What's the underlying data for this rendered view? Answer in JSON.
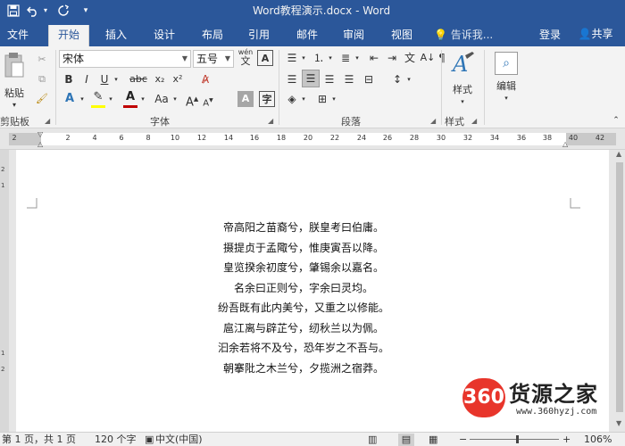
{
  "titlebar": {
    "title": "Word教程演示.docx - Word",
    "save_icon": "save-icon",
    "undo_icon": "undo-icon",
    "redo_icon": "redo-icon",
    "customize_icon": "chevron-down-icon",
    "bg_color": "#2b579a"
  },
  "tabs": [
    {
      "label": "文件"
    },
    {
      "label": "开始",
      "active": true
    },
    {
      "label": "插入"
    },
    {
      "label": "设计"
    },
    {
      "label": "布局"
    },
    {
      "label": "引用"
    },
    {
      "label": "邮件"
    },
    {
      "label": "审阅"
    },
    {
      "label": "视图"
    }
  ],
  "tell_me": "告诉我...",
  "login": "登录",
  "share": "共享",
  "ribbon": {
    "clipboard": {
      "paste": "粘贴",
      "group_label": "剪贴板"
    },
    "font": {
      "font_name": "宋体",
      "font_size": "五号",
      "wen": "wén",
      "group_label": "字体",
      "bold": "B",
      "italic": "I",
      "underline": "U",
      "strike": "abc",
      "sub": "x₂",
      "sup": "x²",
      "clear_A": "A",
      "highlight_color": "#ffff00",
      "font_color": "#c00000",
      "aa": "Aa",
      "grow": "A",
      "shrink": "A",
      "char_border": "A"
    },
    "paragraph": {
      "group_label": "段落"
    },
    "styles": {
      "label": "样式",
      "group_label": "样式"
    },
    "editing": {
      "label": "编辑"
    }
  },
  "ruler_ticks": [
    "2",
    "2",
    "4",
    "6",
    "8",
    "10",
    "12",
    "14",
    "16",
    "18",
    "20",
    "22",
    "24",
    "26",
    "28",
    "30",
    "32",
    "34",
    "36",
    "38",
    "40",
    "42"
  ],
  "vruler_ticks": [
    "2",
    "1",
    "1",
    "2"
  ],
  "document": {
    "lines": [
      "帝高阳之苗裔兮，朕皇考曰伯庸。",
      "摄提贞于孟陬兮，惟庚寅吾以降。",
      "皇览揆余初度兮，肇锡余以嘉名。",
      "名余曰正则兮，字余曰灵均。",
      "纷吾既有此内美兮，又重之以修能。",
      "扈江离与辟芷兮，纫秋兰以为佩。",
      "汩余若将不及兮，恐年岁之不吾与。",
      "朝搴阰之木兰兮，夕揽洲之宿莽。"
    ]
  },
  "watermark": {
    "logo": "360",
    "name": "货源之家",
    "url": "www.360hyzj.com"
  },
  "statusbar": {
    "page": "第 1 页，共 1 页",
    "words": "120 个字",
    "lang": "中文(中国)",
    "zoom": "106%"
  }
}
